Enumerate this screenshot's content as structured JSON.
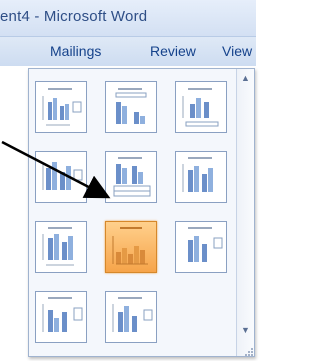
{
  "window": {
    "title": "ent4 - Microsoft Word"
  },
  "ribbon": {
    "tabs": [
      {
        "label": "Mailings"
      },
      {
        "label": "Review"
      },
      {
        "label": "View"
      }
    ]
  },
  "chart_layouts_gallery": {
    "item_count": 11,
    "selected_index": 6,
    "icons": {
      "scroll_up": "scroll-up-arrow-icon",
      "scroll_down": "scroll-down-arrow-icon"
    },
    "colors": {
      "selected_fill": "#f6a44a",
      "bar": "#6b8fc9",
      "line": "#9aa8bd"
    }
  }
}
